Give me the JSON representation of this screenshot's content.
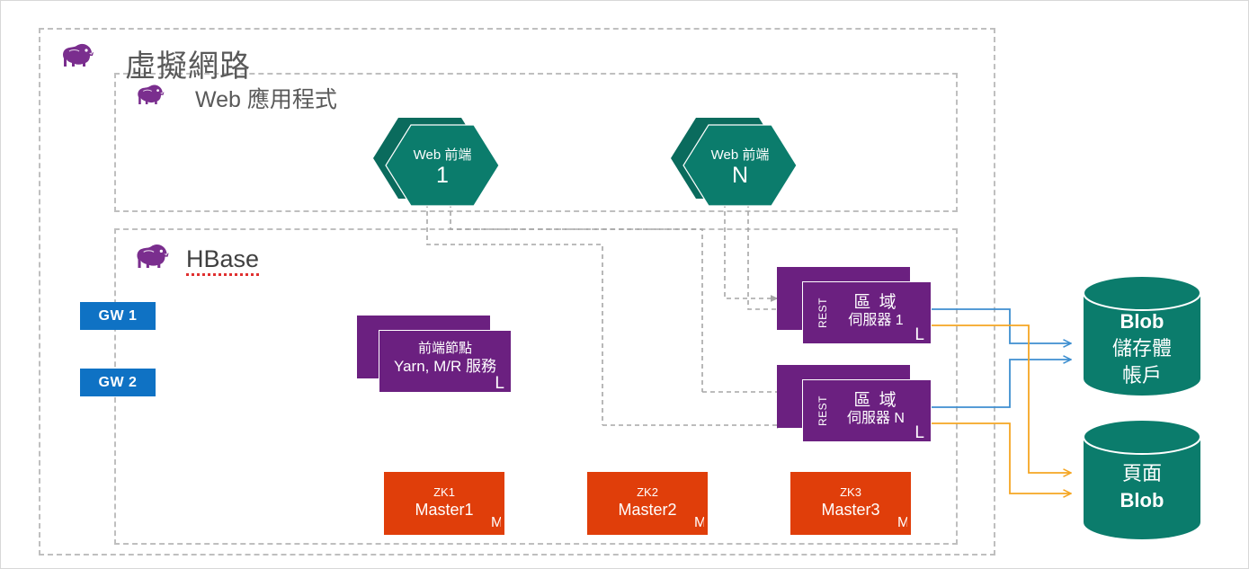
{
  "diagram": {
    "vnet": {
      "title": "虛擬網路",
      "logo_icon": "hadoop-elephant-icon"
    },
    "webapp": {
      "title": "Web 應用程式",
      "logo_icon": "hadoop-elephant-icon"
    },
    "hbase": {
      "title": "HBase",
      "logo_icon": "hadoop-elephant-icon"
    }
  },
  "gateways": [
    {
      "label": "GW 1"
    },
    {
      "label": "GW 2"
    }
  ],
  "web_frontends": [
    {
      "line1": "Web 前端",
      "line2": "1"
    },
    {
      "line1": "Web 前端",
      "line2": "N"
    }
  ],
  "head_node": {
    "line1": "前端節點",
    "line2": "Yarn, M/R 服務",
    "corner": "L"
  },
  "region_servers": [
    {
      "side_label": "REST",
      "line1": "區 域",
      "line2": "伺服器 1",
      "corner": "L"
    },
    {
      "side_label": "REST",
      "line1": "區 域",
      "line2": "伺服器 N",
      "corner": "L"
    }
  ],
  "zookeepers": [
    {
      "line1": "ZK1",
      "line2": "Master1",
      "corner": "M"
    },
    {
      "line1": "ZK2",
      "line2": "Master2",
      "corner": "M"
    },
    {
      "line1": "ZK3",
      "line2": "Master3",
      "corner": "M"
    }
  ],
  "storage": [
    {
      "line1": "Blob",
      "line2": "儲存體",
      "line3": "帳戶"
    },
    {
      "line1": "頁面",
      "line2": "Blob",
      "line3": ""
    }
  ],
  "colors": {
    "teal": "#0B7C6C",
    "teal_dark": "#0A6B5D",
    "purple": "#6B2080",
    "purple_dark": "#6B2080",
    "orange": "#E03E0A",
    "blue": "#0F72C4",
    "wire_blue": "#3E8FD0",
    "wire_orange": "#F5A council",
    "dash_gray": "#BFBFBF",
    "title_gray": "#595959"
  }
}
